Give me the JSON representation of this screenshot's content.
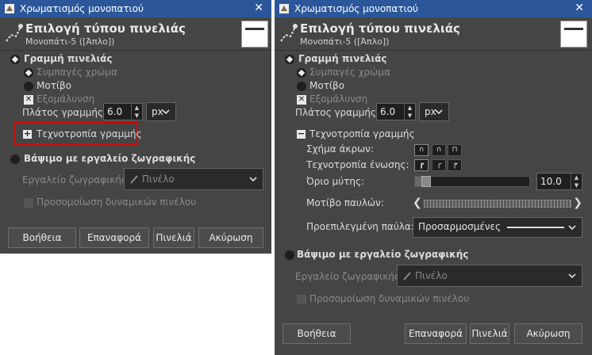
{
  "left": {
    "window_title": "Χρωματισμός μονοπατιού",
    "header_title": "Επιλογή τύπου πινελιάς",
    "header_subtitle": "Μονοπάτι-5 ([Άπλο])",
    "stroke_line_label": "Γραμμή πινελιάς",
    "solid_color_label": "Συμπαγές χρώμα",
    "pattern_label": "Μοτίβο",
    "antialias_label": "Εξομάλυνση",
    "line_width_label": "Πλάτος γραμμής:",
    "line_width_value": "6.0",
    "unit_value": "px",
    "line_style_label": "Τεχνοτροπία γραμμής",
    "paint_tool_section_label": "Βάψιμο με εργαλείο ζωγραφικής",
    "paint_tool_label": "Εργαλείο ζωγραφικής:",
    "paint_tool_value": "Πινέλο",
    "emulate_label": "Προσομοίωση δυναμικών πινέλου",
    "buttons": {
      "help": "Βοήθεια",
      "reset": "Επαναφορά",
      "stroke": "Πινελιά",
      "cancel": "Ακύρωση"
    }
  },
  "right": {
    "window_title": "Χρωματισμός μονοπατιού",
    "header_title": "Επιλογή τύπου πινελιάς",
    "header_subtitle": "Μονοπάτι-5 ([Άπλο])",
    "stroke_line_label": "Γραμμή πινελιάς",
    "solid_color_label": "Συμπαγές χρώμα",
    "pattern_label": "Μοτίβο",
    "antialias_label": "Εξομάλυνση",
    "line_width_label": "Πλάτος γραμμής:",
    "line_width_value": "6.0",
    "unit_value": "px",
    "line_style_label": "Τεχνοτροπία γραμμής",
    "cap_style_label": "Σχήμα άκρων:",
    "join_style_label": "Τεχνοτροπία ένωσης:",
    "miter_limit_label": "Όριο μύτης:",
    "miter_limit_value": "10.0",
    "dash_pattern_label": "Μοτίβο παυλών:",
    "dash_preset_label": "Προεπιλεγμένη παύλα:",
    "dash_preset_value": "Προσαρμοσμένες",
    "paint_tool_section_label": "Βάψιμο με εργαλείο ζωγραφικής",
    "paint_tool_label": "Εργαλείο ζωγραφικής:",
    "paint_tool_value": "Πινέλο",
    "emulate_label": "Προσομοίωση δυναμικών πινέλου",
    "buttons": {
      "help": "Βοήθεια",
      "reset": "Επαναφορά",
      "stroke": "Πινελιά",
      "cancel": "Ακύρωση"
    }
  },
  "miter_limit_fraction": 0.1
}
